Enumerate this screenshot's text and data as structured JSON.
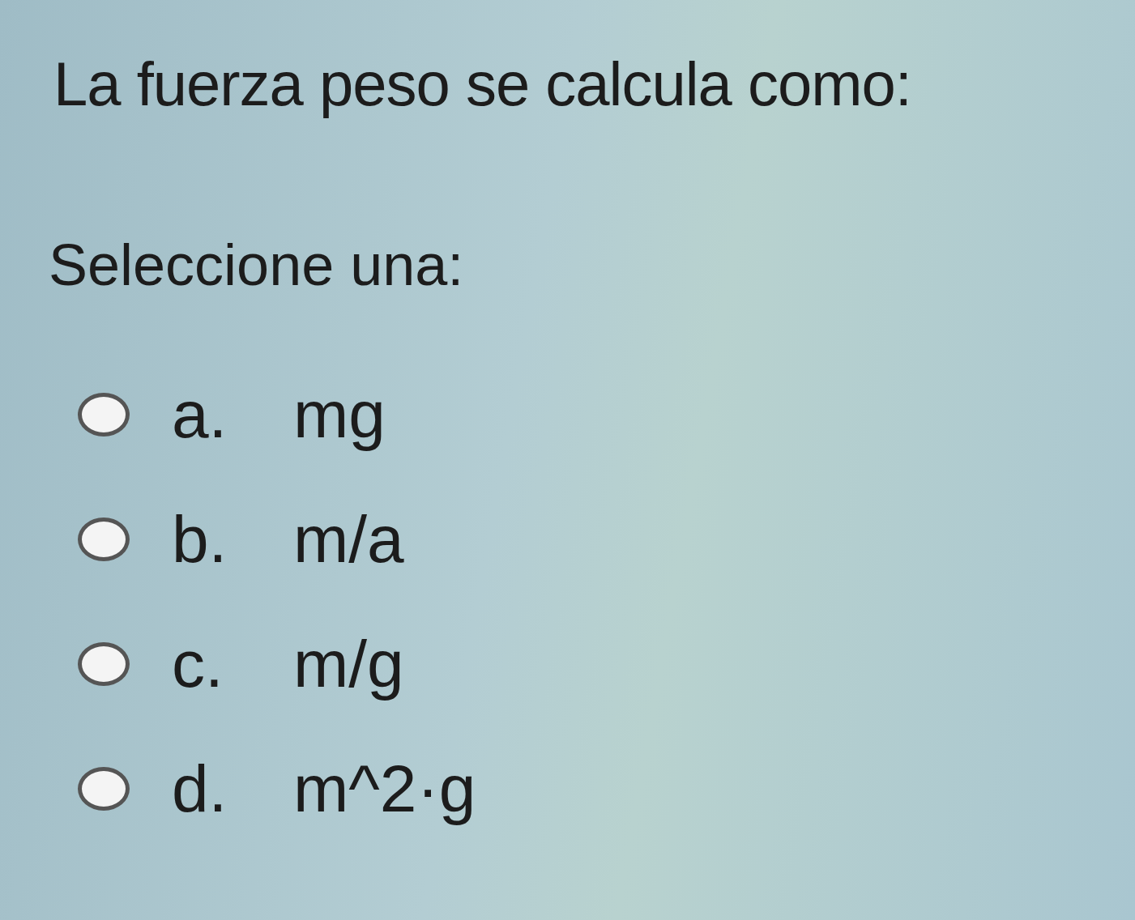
{
  "question": "La fuerza peso se calcula como:",
  "prompt": "Seleccione una:",
  "options": [
    {
      "letter": "a.",
      "answer": "mg",
      "selected": false
    },
    {
      "letter": "b.",
      "answer": "m/a",
      "selected": false
    },
    {
      "letter": "c.",
      "answer": "m/g",
      "selected": false
    },
    {
      "letter": "d.",
      "answer": "m^2·g",
      "selected": false
    }
  ]
}
